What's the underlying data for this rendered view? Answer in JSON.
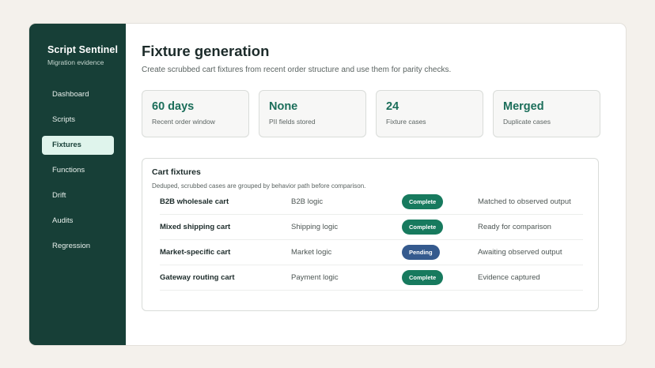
{
  "brand": {
    "title": "Script Sentinel",
    "subtitle": "Migration evidence"
  },
  "nav": [
    {
      "label": "Dashboard",
      "active": false
    },
    {
      "label": "Scripts",
      "active": false
    },
    {
      "label": "Fixtures",
      "active": true
    },
    {
      "label": "Functions",
      "active": false
    },
    {
      "label": "Drift",
      "active": false
    },
    {
      "label": "Audits",
      "active": false
    },
    {
      "label": "Regression",
      "active": false
    }
  ],
  "header": {
    "title": "Fixture generation",
    "subtitle": "Create scrubbed cart fixtures from recent order structure and use them for parity checks."
  },
  "stats": [
    {
      "value": "60 days",
      "label": "Recent order window"
    },
    {
      "value": "None",
      "label": "PII fields stored"
    },
    {
      "value": "24",
      "label": "Fixture cases"
    },
    {
      "value": "Merged",
      "label": "Duplicate cases"
    }
  ],
  "panel": {
    "title": "Cart fixtures",
    "subtitle": "Deduped, scrubbed cases are grouped by behavior path before comparison.",
    "rows": [
      {
        "name": "B2B wholesale cart",
        "logic": "B2B logic",
        "status": "Complete",
        "note": "Matched to observed output"
      },
      {
        "name": "Mixed shipping cart",
        "logic": "Shipping logic",
        "status": "Complete",
        "note": "Ready for comparison"
      },
      {
        "name": "Market-specific cart",
        "logic": "Market logic",
        "status": "Pending",
        "note": "Awaiting observed output"
      },
      {
        "name": "Gateway routing cart",
        "logic": "Payment logic",
        "status": "Complete",
        "note": "Evidence captured"
      }
    ]
  },
  "colors": {
    "complete": "#177a5e",
    "pending": "#355a8e",
    "sidebar": "#173f37",
    "accent": "#1b6e5a"
  }
}
